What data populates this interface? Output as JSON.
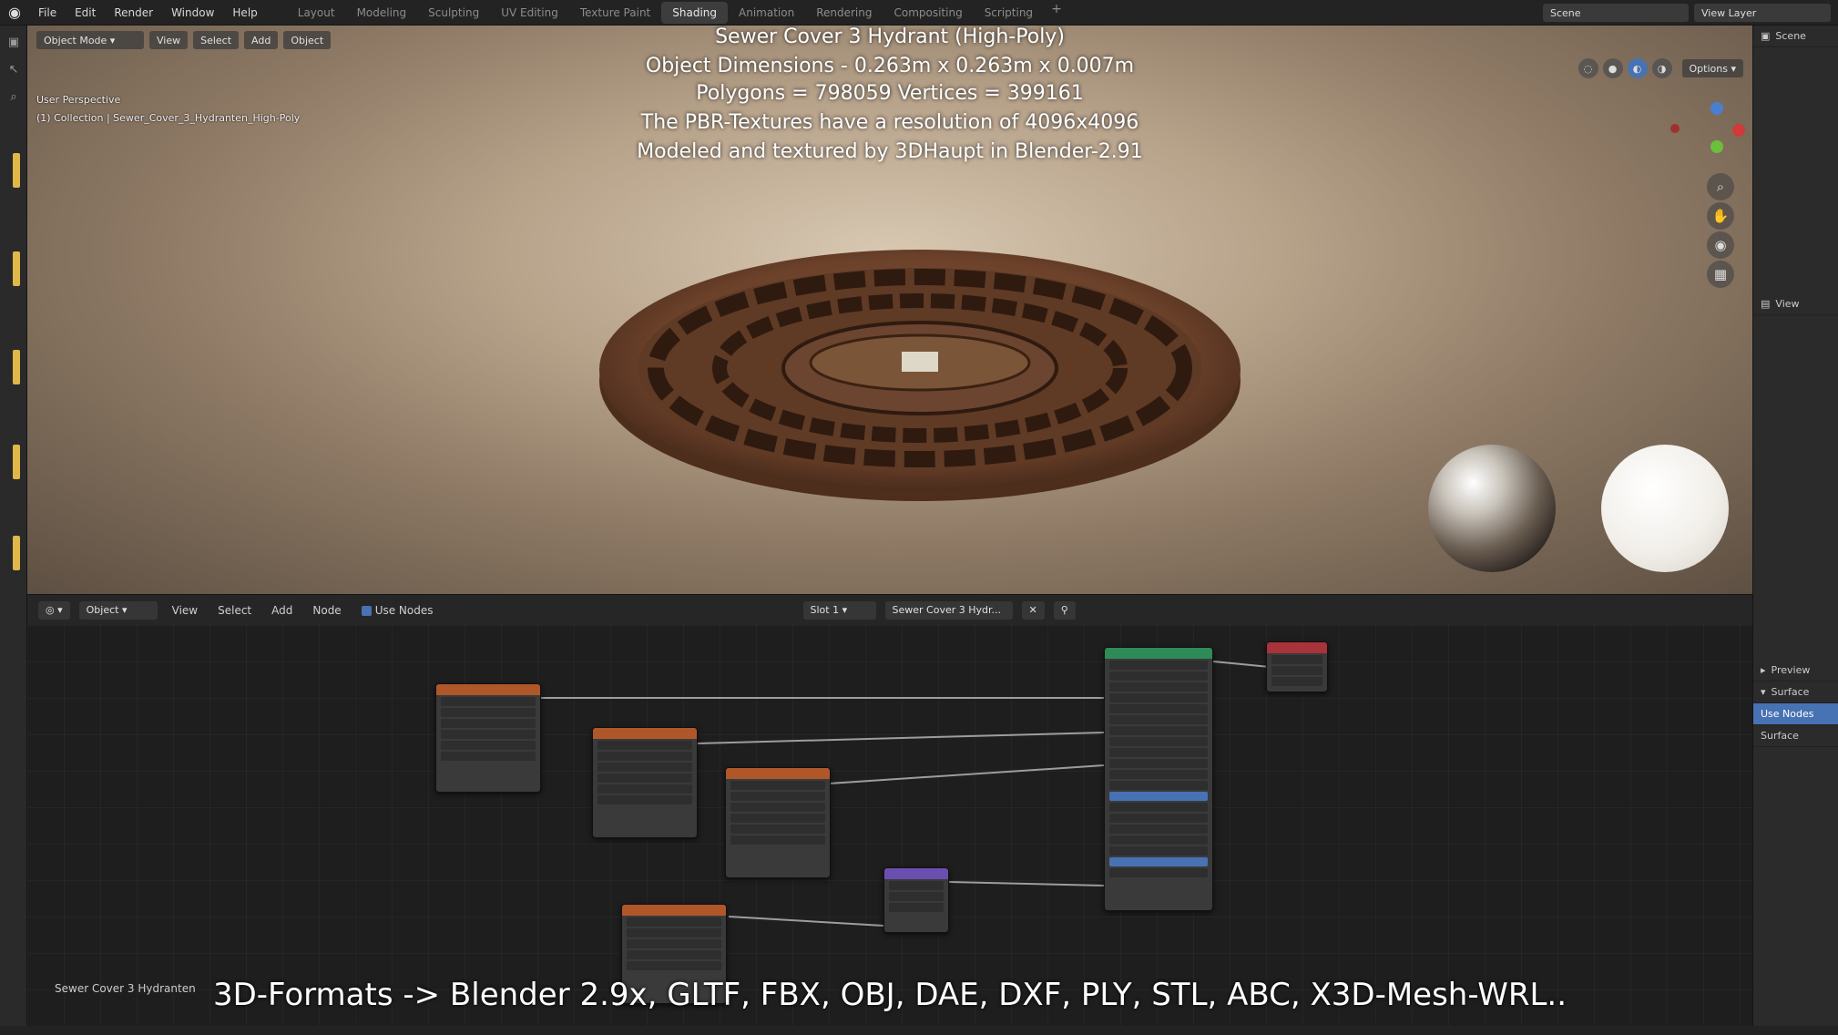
{
  "topbar": {
    "menus": [
      "File",
      "Edit",
      "Render",
      "Window",
      "Help"
    ],
    "workspaces": [
      "Layout",
      "Modeling",
      "Sculpting",
      "UV Editing",
      "Texture Paint",
      "Shading",
      "Animation",
      "Rendering",
      "Compositing",
      "Scripting"
    ],
    "active_workspace": "Shading",
    "scene_label": "Scene",
    "view_layer_label": "View Layer"
  },
  "viewport": {
    "mode": "Object Mode",
    "menus": [
      "View",
      "Select",
      "Add",
      "Object"
    ],
    "perspective": "User Perspective",
    "collection": "(1) Collection | Sewer_Cover_3_Hydranten_High-Poly",
    "options_label": "Options",
    "overlay_lines": [
      "Sewer Cover 3 Hydrant (High-Poly)",
      "Object Dimensions - 0.263m x 0.263m x 0.007m",
      "Polygons = 798059  Vertices = 399161",
      "The PBR-Textures have a resolution of 4096x4096",
      "Modeled and textured by 3DHaupt in Blender-2.91"
    ],
    "gizmo": {
      "z": "Z",
      "x": "X"
    }
  },
  "right_panel": {
    "items": [
      "Scene",
      "View",
      "Preview",
      "Surface",
      "Use Nodes",
      "Surface"
    ]
  },
  "node_header": {
    "object_label": "Object",
    "menus": [
      "View",
      "Select",
      "Add",
      "Node"
    ],
    "use_nodes_label": "Use Nodes",
    "slot_label": "Slot 1",
    "material_name": "Sewer Cover 3 Hydr..."
  },
  "node_editor": {
    "material_label": "Sewer Cover 3 Hydranten",
    "subtitle": "3D-Formats -> Blender 2.9x, GLTF, FBX, OBJ, DAE, DXF, PLY, STL, ABC, X3D-Mesh-WRL.."
  },
  "colors": {
    "texture_node_header": "#b0572a",
    "bsdf_header": "#2e8b57",
    "output_header": "#a8333a",
    "normal_map_header": "#6a4fb0",
    "accent": "#4772b3"
  }
}
